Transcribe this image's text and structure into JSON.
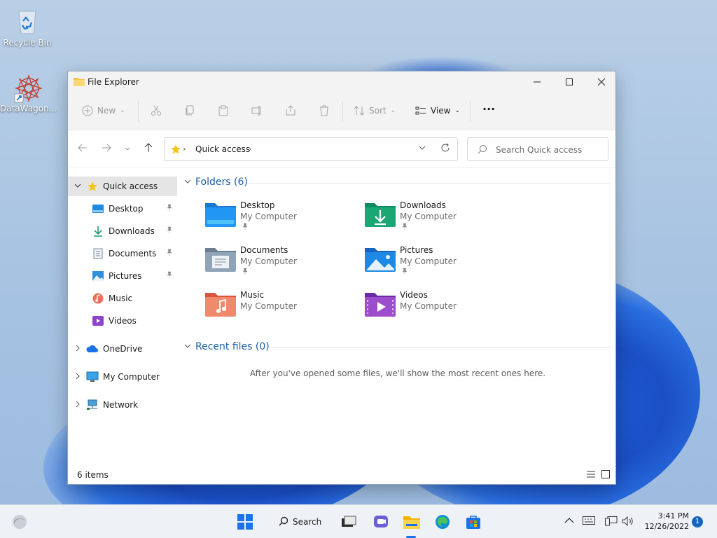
{
  "desktop": {
    "icons": [
      {
        "label": "Recycle Bin",
        "icon": "recycle-bin-icon"
      },
      {
        "label": "DataWagon...",
        "icon": "datawagon-shortcut-icon"
      }
    ]
  },
  "window": {
    "title": "File Explorer",
    "controls": {
      "minimize": "—",
      "maximize": "☐",
      "close": "✕"
    }
  },
  "command_bar": {
    "new_label": "New",
    "sort_label": "Sort",
    "view_label": "View",
    "more_label": "···"
  },
  "address_bar": {
    "crumb": "Quick access",
    "separator": "›"
  },
  "search": {
    "placeholder": "Search Quick access"
  },
  "sidebar": {
    "quick_access": "Quick access",
    "pinned": [
      {
        "label": "Desktop",
        "pinned": true
      },
      {
        "label": "Downloads",
        "pinned": true
      },
      {
        "label": "Documents",
        "pinned": true
      },
      {
        "label": "Pictures",
        "pinned": true
      },
      {
        "label": "Music",
        "pinned": false
      },
      {
        "label": "Videos",
        "pinned": false
      }
    ],
    "roots": [
      {
        "label": "OneDrive"
      },
      {
        "label": "My Computer"
      },
      {
        "label": "Network"
      }
    ]
  },
  "folders_section": {
    "heading": "Folders (6)",
    "items": [
      {
        "name": "Desktop",
        "location": "My Computer",
        "pinned": true
      },
      {
        "name": "Downloads",
        "location": "My Computer",
        "pinned": true
      },
      {
        "name": "Documents",
        "location": "My Computer",
        "pinned": true
      },
      {
        "name": "Pictures",
        "location": "My Computer",
        "pinned": true
      },
      {
        "name": "Music",
        "location": "My Computer",
        "pinned": false
      },
      {
        "name": "Videos",
        "location": "My Computer",
        "pinned": false
      }
    ]
  },
  "recent_section": {
    "heading": "Recent files (0)",
    "empty_message": "After you've opened some files, we'll show the most recent ones here."
  },
  "status_bar": {
    "item_count": "6 items"
  },
  "taskbar": {
    "search_label": "Search",
    "time": "3:41 PM",
    "date": "12/26/2022",
    "notification_count": "1"
  },
  "colors": {
    "accent": "#1a73e8",
    "section_heading": "#1b5ea6",
    "selection": "#e5e5e5"
  }
}
